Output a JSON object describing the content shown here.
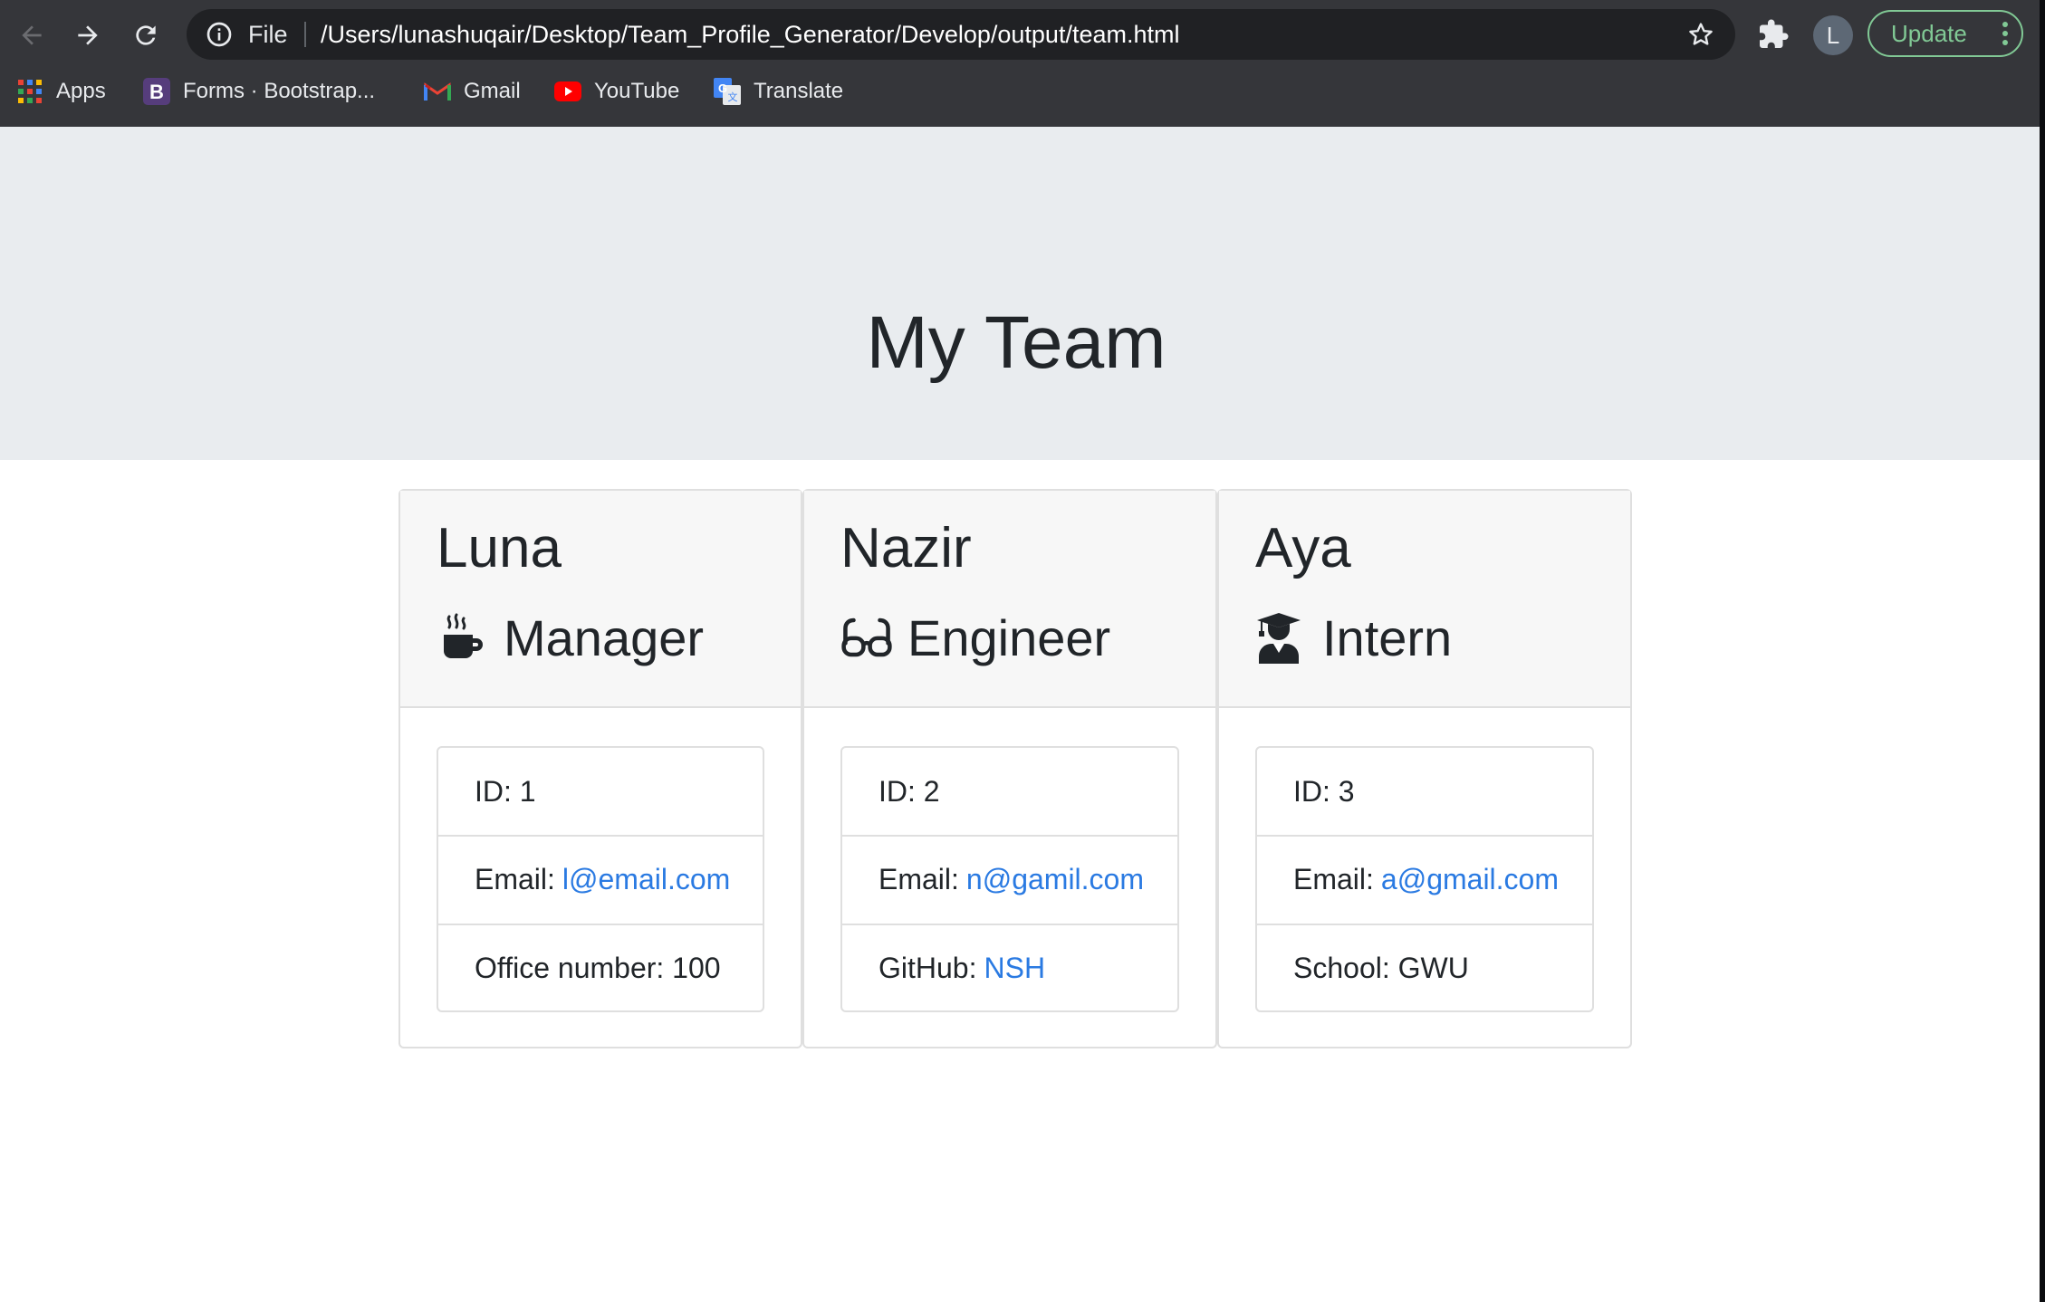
{
  "browser": {
    "omnibox": {
      "scheme_label": "File",
      "url": "/Users/lunashuqair/Desktop/Team_Profile_Generator/Develop/output/team.html"
    },
    "avatar_letter": "L",
    "update_label": "Update",
    "bookmarks": [
      {
        "label": "Apps",
        "icon": "apps-grid-icon"
      },
      {
        "label": "Forms · Bootstrap...",
        "icon": "bootstrap-icon"
      },
      {
        "label": "Gmail",
        "icon": "gmail-icon"
      },
      {
        "label": "YouTube",
        "icon": "youtube-icon"
      },
      {
        "label": "Translate",
        "icon": "translate-icon"
      }
    ]
  },
  "page": {
    "title": "My Team",
    "members": [
      {
        "name": "Luna",
        "role": "Manager",
        "role_icon": "coffee-mug-icon",
        "id_text": "ID: 1",
        "email_label": "Email:",
        "email": "l@email.com",
        "extra_label": "Office number: 100",
        "extra_link": ""
      },
      {
        "name": "Nazir",
        "role": "Engineer",
        "role_icon": "glasses-icon",
        "id_text": "ID: 2",
        "email_label": "Email:",
        "email": "n@gamil.com",
        "extra_label": "GitHub:",
        "extra_link": "NSH"
      },
      {
        "name": "Aya",
        "role": "Intern",
        "role_icon": "graduate-icon",
        "id_text": "ID: 3",
        "email_label": "Email:",
        "email": "a@gmail.com",
        "extra_label": "School: GWU",
        "extra_link": ""
      }
    ]
  },
  "colors": {
    "chrome_bg": "#35363a",
    "omnibox_bg": "#202124",
    "jumbotron_bg": "#e9ecef",
    "link": "#2a7ae2",
    "update_green": "#81c995"
  }
}
